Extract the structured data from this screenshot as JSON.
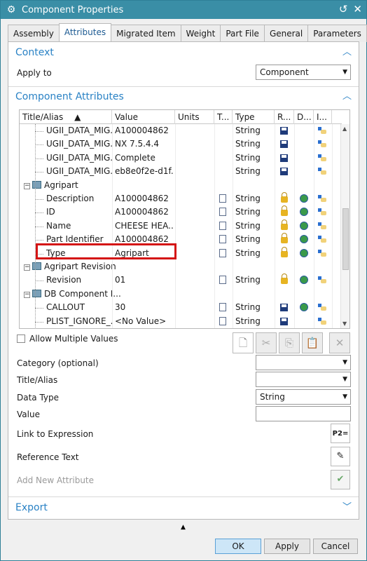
{
  "window": {
    "title": "Component Properties",
    "title_icon": "gear-icon"
  },
  "tabs": [
    "Assembly",
    "Attributes",
    "Migrated Item",
    "Weight",
    "Part File",
    "General",
    "Parameters"
  ],
  "context": {
    "heading": "Context",
    "apply_to_label": "Apply to",
    "apply_to_value": "Component"
  },
  "component_attributes": {
    "heading": "Component Attributes",
    "columns": [
      "Title/Alias",
      "Value",
      "Units",
      "T...",
      "Type",
      "R...",
      "D...",
      "I..."
    ],
    "rows": [
      {
        "title": "UGII_DATA_MIG...",
        "value": "A100004862",
        "type": "String",
        "icons": [
          "save"
        ],
        "level": 2
      },
      {
        "title": "UGII_DATA_MIG...",
        "value": "NX 7.5.4.4",
        "type": "String",
        "icons": [
          "save"
        ],
        "level": 2
      },
      {
        "title": "UGII_DATA_MIG...",
        "value": "Complete",
        "type": "String",
        "icons": [
          "save"
        ],
        "level": 2
      },
      {
        "title": "UGII_DATA_MIG...",
        "value": "eb8e0f2e-d1f...",
        "type": "String",
        "icons": [
          "save"
        ],
        "level": 2
      },
      {
        "title": "Agripart",
        "value": "",
        "type": "",
        "icons": [],
        "level": 1,
        "group": true
      },
      {
        "title": "Description",
        "value": "A100004862",
        "type": "String",
        "icons": [
          "lock",
          "globe"
        ],
        "level": 2,
        "doc": true
      },
      {
        "title": "ID",
        "value": "A100004862",
        "type": "String",
        "icons": [
          "lock",
          "globe"
        ],
        "level": 2,
        "doc": true
      },
      {
        "title": "Name",
        "value": "CHEESE HEA...",
        "type": "String",
        "icons": [
          "lock",
          "globe"
        ],
        "level": 2,
        "doc": true
      },
      {
        "title": "Part Identifier",
        "value": "A100004862",
        "type": "String",
        "icons": [
          "lock",
          "globe"
        ],
        "level": 2,
        "doc": true
      },
      {
        "title": "Type",
        "value": "Agripart",
        "type": "String",
        "icons": [
          "lock",
          "globe"
        ],
        "level": 2,
        "doc": true
      },
      {
        "title": "Agripart Revision",
        "value": "",
        "type": "",
        "icons": [],
        "level": 1,
        "group": true
      },
      {
        "title": "Revision",
        "value": "01",
        "type": "String",
        "icons": [
          "lock",
          "globe"
        ],
        "level": 2,
        "doc": true
      },
      {
        "title": "DB Component I...",
        "value": "",
        "type": "",
        "icons": [],
        "level": 1,
        "group": true
      },
      {
        "title": "CALLOUT",
        "value": "30",
        "type": "String",
        "icons": [
          "save",
          "globe"
        ],
        "level": 2,
        "doc": true
      },
      {
        "title": "PLIST_IGNORE_...",
        "value": "<No Value>",
        "type": "String",
        "icons": [
          "save"
        ],
        "level": 2,
        "doc": true
      }
    ]
  },
  "allow_multiple_values": "Allow Multiple Values",
  "form": {
    "category_label": "Category (optional)",
    "title_label": "Title/Alias",
    "datatype_label": "Data Type",
    "datatype_value": "String",
    "value_label": "Value",
    "link_label": "Link to Expression",
    "reference_label": "Reference Text",
    "add_label": "Add New Attribute"
  },
  "export": {
    "heading": "Export"
  },
  "footer": {
    "ok": "OK",
    "apply": "Apply",
    "cancel": "Cancel"
  }
}
